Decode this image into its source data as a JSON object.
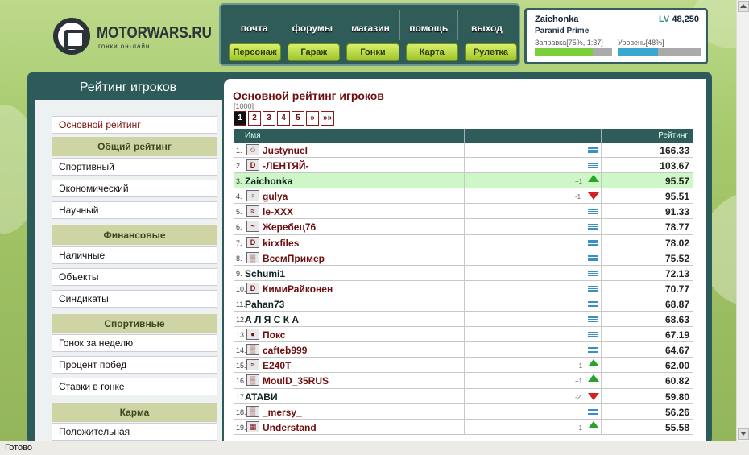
{
  "logo": {
    "title": "MOTORWARS.RU",
    "subtitle": "гонки он-лайн"
  },
  "topnav": {
    "items": [
      "почта",
      "форумы",
      "магазин",
      "помощь",
      "выход"
    ],
    "green": [
      "Персонаж",
      "Гараж",
      "Гонки",
      "Карта",
      "Рулетка"
    ]
  },
  "user": {
    "nick": "Zaichonka",
    "lv_label": "LV",
    "lv_value": "48,250",
    "car": "Paranid Prime",
    "fuel_label": "Заправка[75%, 1:37]",
    "fuel_level": 0.75,
    "level_label": "Уровень[48%]",
    "level_level": 0.48
  },
  "sidebar": {
    "title": "Рейтинг игроков",
    "selected": "Основной рейтинг",
    "groups": [
      {
        "header": "Общий рейтинг",
        "items": [
          "Спортивный",
          "Экономический",
          "Научный"
        ]
      },
      {
        "header": "Финансовые",
        "items": [
          "Наличные",
          "Объекты",
          "Синдикаты"
        ]
      },
      {
        "header": "Спортивные",
        "items": [
          "Гонок за неделю",
          "Процент побед",
          "Ставки в гонке"
        ]
      },
      {
        "header": "Карма",
        "items": [
          "Положительная"
        ]
      }
    ]
  },
  "main": {
    "title": "Основной рейтинг игроков",
    "count": "[1000]",
    "pages": [
      "1",
      "2",
      "3",
      "4",
      "5",
      "»",
      "»»"
    ],
    "col_name": "Имя",
    "col_rating": "Рейтинг"
  },
  "rows": [
    {
      "n": "1.",
      "name": "Justynuel",
      "delta": "",
      "trend": "stay",
      "score": "166.33",
      "av": "☺"
    },
    {
      "n": "2.",
      "name": "-ЛЕНТЯЙ-",
      "delta": "",
      "trend": "stay",
      "score": "103.67",
      "av": "D"
    },
    {
      "n": "3.",
      "name": "Zaichonka",
      "delta": "+1",
      "trend": "up",
      "score": "95.57",
      "av": ""
    },
    {
      "n": "4.",
      "name": "gulya",
      "delta": "-1",
      "trend": "down",
      "score": "95.51",
      "av": "♀"
    },
    {
      "n": "5.",
      "name": "le-XXX",
      "delta": "",
      "trend": "stay",
      "score": "91.33",
      "av": "≈"
    },
    {
      "n": "6.",
      "name": "Жеребец76",
      "delta": "",
      "trend": "stay",
      "score": "78.77",
      "av": "~"
    },
    {
      "n": "7.",
      "name": "kirxfiles",
      "delta": "",
      "trend": "stay",
      "score": "78.02",
      "av": "D"
    },
    {
      "n": "8.",
      "name": "ВсемПример",
      "delta": "",
      "trend": "stay",
      "score": "75.52",
      "av": "▒"
    },
    {
      "n": "9.",
      "name": "Schumi1",
      "delta": "",
      "trend": "stay",
      "score": "72.13",
      "av": ""
    },
    {
      "n": "10.",
      "name": "КимиРайконен",
      "delta": "",
      "trend": "stay",
      "score": "70.77",
      "av": "D"
    },
    {
      "n": "11.",
      "name": "Pahan73",
      "delta": "",
      "trend": "stay",
      "score": "68.87",
      "av": ""
    },
    {
      "n": "12.",
      "name": "А Л Я С К А",
      "delta": "",
      "trend": "stay",
      "score": "68.63",
      "av": ""
    },
    {
      "n": "13.",
      "name": "Покс",
      "delta": "",
      "trend": "stay",
      "score": "67.19",
      "av": "●"
    },
    {
      "n": "14.",
      "name": "cafteb999",
      "delta": "",
      "trend": "stay",
      "score": "64.67",
      "av": "▒"
    },
    {
      "n": "15.",
      "name": "E240T",
      "delta": "+1",
      "trend": "up",
      "score": "62.00",
      "av": "≈"
    },
    {
      "n": "16.",
      "name": "MoulD_35RUS",
      "delta": "+1",
      "trend": "up",
      "score": "60.82",
      "av": "▒"
    },
    {
      "n": "17.",
      "name": "АТАВИ",
      "delta": "-2",
      "trend": "down",
      "score": "59.80",
      "av": ""
    },
    {
      "n": "18.",
      "name": "_mersy_",
      "delta": "",
      "trend": "stay",
      "score": "56.26",
      "av": "▒"
    },
    {
      "n": "19.",
      "name": "Understand",
      "delta": "+1",
      "trend": "up",
      "score": "55.58",
      "av": "▦"
    }
  ],
  "status": "Готово",
  "colors": {
    "accent": "#2e5c5a",
    "title": "#6e0e0e",
    "me_row": "#cdf7c6",
    "green_btn": "#b5dc3c"
  }
}
